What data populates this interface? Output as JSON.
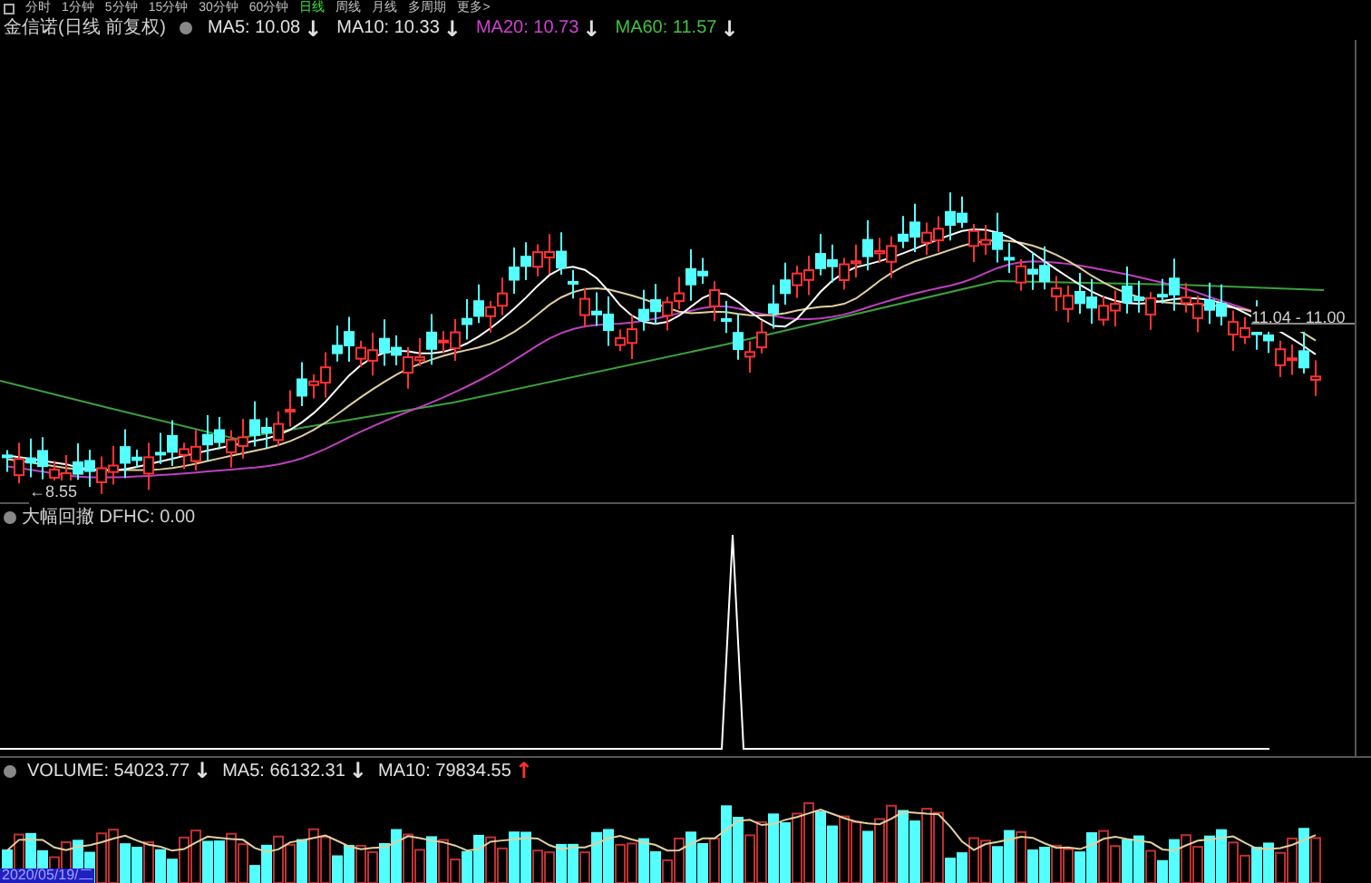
{
  "periods": [
    {
      "label": "分时",
      "selected": false
    },
    {
      "label": "1分钟",
      "selected": false
    },
    {
      "label": "5分钟",
      "selected": false
    },
    {
      "label": "15分钟",
      "selected": false
    },
    {
      "label": "30分钟",
      "selected": false
    },
    {
      "label": "60分钟",
      "selected": false
    },
    {
      "label": "日线",
      "selected": true
    },
    {
      "label": "周线",
      "selected": false
    },
    {
      "label": "月线",
      "selected": false
    },
    {
      "label": "多周期",
      "selected": false
    },
    {
      "label": "更多>",
      "selected": false
    }
  ],
  "price_panel": {
    "title": "金信诺(日线 前复权)",
    "indicators": [
      {
        "name": "MA5:",
        "value": "10.08",
        "color": "#e0e0e0",
        "arrow": {
          "text": "↓",
          "color": "#e0e0e0"
        }
      },
      {
        "name": "MA10:",
        "value": "10.33",
        "color": "#e0e0e0",
        "arrow": {
          "text": "↓",
          "color": "#e0e0e0"
        }
      },
      {
        "name": "MA20:",
        "value": "10.73",
        "color": "#d040d0",
        "arrow": {
          "text": "↓",
          "color": "#e0e0e0"
        }
      },
      {
        "name": "MA60:",
        "value": "11.57",
        "color": "#40c040",
        "arrow": {
          "text": "↓",
          "color": "#e0e0e0"
        }
      }
    ],
    "low_label": "←8.55",
    "range_label": "11.04 - 11.00"
  },
  "indicator_panel": {
    "title": "大幅回撤 DFHC: 0.00"
  },
  "volume_panel": {
    "indicators": [
      {
        "name": "VOLUME:",
        "value": "54023.77",
        "color": "#e0e0e0",
        "arrow": {
          "text": "↓",
          "color": "#e0e0e0"
        }
      },
      {
        "name": "MA5:",
        "value": "66132.31",
        "color": "#e0e0e0",
        "arrow": {
          "text": "↓",
          "color": "#e0e0e0"
        }
      },
      {
        "name": "MA10:",
        "value": "79834.55",
        "color": "#e0e0e0",
        "arrow": {
          "text": "↑",
          "color": "#ff3030"
        }
      }
    ],
    "date_label": "2020/05/19/二"
  }
}
